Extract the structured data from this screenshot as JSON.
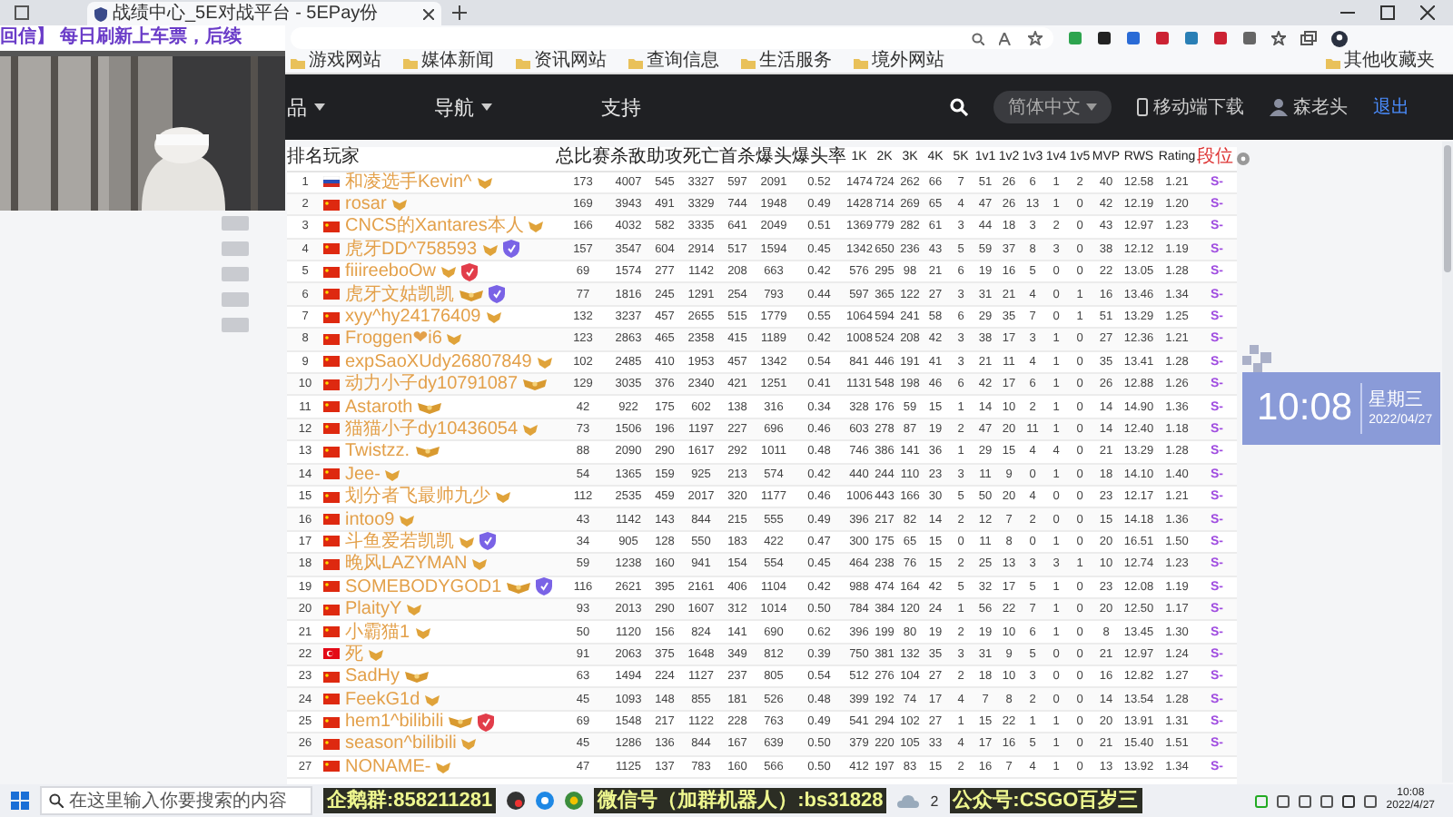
{
  "browser": {
    "tab_title": "战绩中心_5E对战平台 - 5EPay份",
    "bookmarks": [
      "游戏网站",
      "媒体新闻",
      "资讯网站",
      "查询信息",
      "生活服务",
      "境外网站"
    ],
    "other_bookmarks": "其他收藏夹"
  },
  "stream_banner": "回信】 每日刷新上车票，后续",
  "nav": {
    "items": [
      {
        "label": "品",
        "dropdown": true
      },
      {
        "label": "导航",
        "dropdown": true
      },
      {
        "label": "支持",
        "dropdown": false
      }
    ],
    "language": "简体中文",
    "mobile": "移动端下载",
    "user": "森老头",
    "logout": "退出"
  },
  "table": {
    "columns": [
      "排名",
      "玩家",
      "总比赛",
      "杀敌",
      "助攻",
      "死亡",
      "首杀",
      "爆头",
      "爆头率",
      "1K",
      "2K",
      "3K",
      "4K",
      "5K",
      "1v1",
      "1v2",
      "1v3",
      "1v4",
      "1v5",
      "MVP",
      "RWS",
      "Rating",
      "段位"
    ],
    "rows": [
      {
        "rank": "1",
        "flag": {
          "kind": "ru"
        },
        "name": "和凌选手Kevin^",
        "badges": [
          {
            "kind": "gold"
          }
        ],
        "stats": [
          "173",
          "4007",
          "545",
          "3327",
          "597",
          "2091",
          "0.52",
          "1474",
          "724",
          "262",
          "66",
          "7",
          "51",
          "26",
          "6",
          "1",
          "2",
          "40",
          "12.58",
          "1.21"
        ],
        "tier": "S-"
      },
      {
        "rank": "2",
        "flag": {
          "kind": "cn"
        },
        "name": "rosar",
        "badges": [
          {
            "kind": "gold"
          }
        ],
        "stats": [
          "169",
          "3943",
          "491",
          "3329",
          "744",
          "1948",
          "0.49",
          "1428",
          "714",
          "269",
          "65",
          "4",
          "47",
          "26",
          "13",
          "1",
          "0",
          "42",
          "12.19",
          "1.20"
        ],
        "tier": "S-"
      },
      {
        "rank": "3",
        "flag": {
          "kind": "cn"
        },
        "name": "CNCS的Xantares本人",
        "badges": [
          {
            "kind": "gold"
          }
        ],
        "stats": [
          "166",
          "4032",
          "582",
          "3335",
          "641",
          "2049",
          "0.51",
          "1369",
          "779",
          "282",
          "61",
          "3",
          "44",
          "18",
          "3",
          "2",
          "0",
          "43",
          "12.97",
          "1.23"
        ],
        "tier": "S-"
      },
      {
        "rank": "4",
        "flag": {
          "kind": "cn"
        },
        "name": "虎牙DD^758593",
        "badges": [
          {
            "kind": "gold"
          },
          {
            "kind": "purple"
          }
        ],
        "stats": [
          "157",
          "3547",
          "604",
          "2914",
          "517",
          "1594",
          "0.45",
          "1342",
          "650",
          "236",
          "43",
          "5",
          "59",
          "37",
          "8",
          "3",
          "0",
          "38",
          "12.12",
          "1.19"
        ],
        "tier": "S-"
      },
      {
        "rank": "5",
        "flag": {
          "kind": "cn"
        },
        "name": "fiiireeboOw",
        "badges": [
          {
            "kind": "gold"
          },
          {
            "kind": "red"
          }
        ],
        "stats": [
          "69",
          "1574",
          "277",
          "1142",
          "208",
          "663",
          "0.42",
          "576",
          "295",
          "98",
          "21",
          "6",
          "19",
          "16",
          "5",
          "0",
          "0",
          "22",
          "13.05",
          "1.28"
        ],
        "tier": "S-"
      },
      {
        "rank": "6",
        "flag": {
          "kind": "cn"
        },
        "name": "虎牙文姑凯凯",
        "badges": [
          {
            "kind": "gold2"
          },
          {
            "kind": "purple"
          }
        ],
        "stats": [
          "77",
          "1816",
          "245",
          "1291",
          "254",
          "793",
          "0.44",
          "597",
          "365",
          "122",
          "27",
          "3",
          "31",
          "21",
          "4",
          "0",
          "1",
          "16",
          "13.46",
          "1.34"
        ],
        "tier": "S-"
      },
      {
        "rank": "7",
        "flag": {
          "kind": "cn"
        },
        "name": "xyy^hy24176409",
        "badges": [
          {
            "kind": "gold"
          }
        ],
        "stats": [
          "132",
          "3237",
          "457",
          "2655",
          "515",
          "1779",
          "0.55",
          "1064",
          "594",
          "241",
          "58",
          "6",
          "29",
          "35",
          "7",
          "0",
          "1",
          "51",
          "13.29",
          "1.25"
        ],
        "tier": "S-"
      },
      {
        "rank": "8",
        "flag": {
          "kind": "cn"
        },
        "name": "Froggen❤i6",
        "badges": [
          {
            "kind": "gold"
          }
        ],
        "stats": [
          "123",
          "2863",
          "465",
          "2358",
          "415",
          "1189",
          "0.42",
          "1008",
          "524",
          "208",
          "42",
          "3",
          "38",
          "17",
          "3",
          "1",
          "0",
          "27",
          "12.36",
          "1.21"
        ],
        "tier": "S-"
      },
      {
        "rank": "9",
        "flag": {
          "kind": "cn"
        },
        "name": "expSaoXUdy26807849",
        "badges": [
          {
            "kind": "gold"
          }
        ],
        "stats": [
          "102",
          "2485",
          "410",
          "1953",
          "457",
          "1342",
          "0.54",
          "841",
          "446",
          "191",
          "41",
          "3",
          "21",
          "11",
          "4",
          "1",
          "0",
          "35",
          "13.41",
          "1.28"
        ],
        "tier": "S-"
      },
      {
        "rank": "10",
        "flag": {
          "kind": "cn"
        },
        "name": "动力小子dy10791087",
        "badges": [
          {
            "kind": "gold2"
          }
        ],
        "stats": [
          "129",
          "3035",
          "376",
          "2340",
          "421",
          "1251",
          "0.41",
          "1131",
          "548",
          "198",
          "46",
          "6",
          "42",
          "17",
          "6",
          "1",
          "0",
          "26",
          "12.88",
          "1.26"
        ],
        "tier": "S-"
      },
      {
        "rank": "11",
        "flag": {
          "kind": "cn"
        },
        "name": "Astaroth",
        "badges": [
          {
            "kind": "gold2"
          }
        ],
        "stats": [
          "42",
          "922",
          "175",
          "602",
          "138",
          "316",
          "0.34",
          "328",
          "176",
          "59",
          "15",
          "1",
          "14",
          "10",
          "2",
          "1",
          "0",
          "14",
          "14.90",
          "1.36"
        ],
        "tier": "S-"
      },
      {
        "rank": "12",
        "flag": {
          "kind": "cn"
        },
        "name": "猫猫小子dy10436054",
        "badges": [
          {
            "kind": "gold"
          }
        ],
        "stats": [
          "73",
          "1506",
          "196",
          "1197",
          "227",
          "696",
          "0.46",
          "603",
          "278",
          "87",
          "19",
          "2",
          "47",
          "20",
          "11",
          "1",
          "0",
          "14",
          "12.40",
          "1.18"
        ],
        "tier": "S-"
      },
      {
        "rank": "13",
        "flag": {
          "kind": "cn"
        },
        "name": "Twistzz.",
        "badges": [
          {
            "kind": "gold2"
          }
        ],
        "stats": [
          "88",
          "2090",
          "290",
          "1617",
          "292",
          "1011",
          "0.48",
          "746",
          "386",
          "141",
          "36",
          "1",
          "29",
          "15",
          "4",
          "4",
          "0",
          "21",
          "13.29",
          "1.28"
        ],
        "tier": "S-"
      },
      {
        "rank": "14",
        "flag": {
          "kind": "cn"
        },
        "name": "Jee-",
        "badges": [
          {
            "kind": "gold"
          }
        ],
        "stats": [
          "54",
          "1365",
          "159",
          "925",
          "213",
          "574",
          "0.42",
          "440",
          "244",
          "110",
          "23",
          "3",
          "11",
          "9",
          "0",
          "1",
          "0",
          "18",
          "14.10",
          "1.40"
        ],
        "tier": "S-"
      },
      {
        "rank": "15",
        "flag": {
          "kind": "cn"
        },
        "name": "划分者飞最帅九少",
        "badges": [
          {
            "kind": "gold"
          }
        ],
        "stats": [
          "112",
          "2535",
          "459",
          "2017",
          "320",
          "1177",
          "0.46",
          "1006",
          "443",
          "166",
          "30",
          "5",
          "50",
          "20",
          "4",
          "0",
          "0",
          "23",
          "12.17",
          "1.21"
        ],
        "tier": "S-"
      },
      {
        "rank": "16",
        "flag": {
          "kind": "cn"
        },
        "name": "intoo9",
        "badges": [
          {
            "kind": "gold"
          }
        ],
        "stats": [
          "43",
          "1142",
          "143",
          "844",
          "215",
          "555",
          "0.49",
          "396",
          "217",
          "82",
          "14",
          "2",
          "12",
          "7",
          "2",
          "0",
          "0",
          "15",
          "14.18",
          "1.36"
        ],
        "tier": "S-"
      },
      {
        "rank": "17",
        "flag": {
          "kind": "cn"
        },
        "name": "斗鱼爱若凯凯",
        "badges": [
          {
            "kind": "gold"
          },
          {
            "kind": "purple"
          }
        ],
        "stats": [
          "34",
          "905",
          "128",
          "550",
          "183",
          "422",
          "0.47",
          "300",
          "175",
          "65",
          "15",
          "0",
          "11",
          "8",
          "0",
          "1",
          "0",
          "20",
          "16.51",
          "1.50"
        ],
        "tier": "S-"
      },
      {
        "rank": "18",
        "flag": {
          "kind": "cn"
        },
        "name": "晚风LAZYMAN",
        "badges": [
          {
            "kind": "gold"
          }
        ],
        "stats": [
          "59",
          "1238",
          "160",
          "941",
          "154",
          "554",
          "0.45",
          "464",
          "238",
          "76",
          "15",
          "2",
          "25",
          "13",
          "3",
          "3",
          "1",
          "10",
          "12.74",
          "1.23"
        ],
        "tier": "S-"
      },
      {
        "rank": "19",
        "flag": {
          "kind": "cn"
        },
        "name": "SOMEBODYGOD1",
        "badges": [
          {
            "kind": "gold2"
          },
          {
            "kind": "purple"
          }
        ],
        "stats": [
          "116",
          "2621",
          "395",
          "2161",
          "406",
          "1104",
          "0.42",
          "988",
          "474",
          "164",
          "42",
          "5",
          "32",
          "17",
          "5",
          "1",
          "0",
          "23",
          "12.08",
          "1.19"
        ],
        "tier": "S-"
      },
      {
        "rank": "20",
        "flag": {
          "kind": "cn"
        },
        "name": "PlaityY",
        "badges": [
          {
            "kind": "gold"
          }
        ],
        "stats": [
          "93",
          "2013",
          "290",
          "1607",
          "312",
          "1014",
          "0.50",
          "784",
          "384",
          "120",
          "24",
          "1",
          "56",
          "22",
          "7",
          "1",
          "0",
          "20",
          "12.50",
          "1.17"
        ],
        "tier": "S-"
      },
      {
        "rank": "21",
        "flag": {
          "kind": "cn"
        },
        "name": "小霸猫1",
        "badges": [
          {
            "kind": "gold"
          }
        ],
        "stats": [
          "50",
          "1120",
          "156",
          "824",
          "141",
          "690",
          "0.62",
          "396",
          "199",
          "80",
          "19",
          "2",
          "19",
          "10",
          "6",
          "1",
          "0",
          "8",
          "13.45",
          "1.30"
        ],
        "tier": "S-"
      },
      {
        "rank": "22",
        "flag": {
          "kind": "tr"
        },
        "name": "死",
        "badges": [
          {
            "kind": "gold"
          }
        ],
        "stats": [
          "91",
          "2063",
          "375",
          "1648",
          "349",
          "812",
          "0.39",
          "750",
          "381",
          "132",
          "35",
          "3",
          "31",
          "9",
          "5",
          "0",
          "0",
          "21",
          "12.97",
          "1.24"
        ],
        "tier": "S-"
      },
      {
        "rank": "23",
        "flag": {
          "kind": "cn"
        },
        "name": "SadHy",
        "badges": [
          {
            "kind": "gold2"
          }
        ],
        "stats": [
          "63",
          "1494",
          "224",
          "1127",
          "237",
          "805",
          "0.54",
          "512",
          "276",
          "104",
          "27",
          "2",
          "18",
          "10",
          "3",
          "0",
          "0",
          "16",
          "12.82",
          "1.27"
        ],
        "tier": "S-"
      },
      {
        "rank": "24",
        "flag": {
          "kind": "cn"
        },
        "name": "FeekG1d",
        "badges": [
          {
            "kind": "gold"
          }
        ],
        "stats": [
          "45",
          "1093",
          "148",
          "855",
          "181",
          "526",
          "0.48",
          "399",
          "192",
          "74",
          "17",
          "4",
          "7",
          "8",
          "2",
          "0",
          "0",
          "14",
          "13.54",
          "1.28"
        ],
        "tier": "S-"
      },
      {
        "rank": "25",
        "flag": {
          "kind": "cn"
        },
        "name": "hem1^bilibili",
        "badges": [
          {
            "kind": "gold2"
          },
          {
            "kind": "red"
          }
        ],
        "stats": [
          "69",
          "1548",
          "217",
          "1122",
          "228",
          "763",
          "0.49",
          "541",
          "294",
          "102",
          "27",
          "1",
          "15",
          "22",
          "1",
          "1",
          "0",
          "20",
          "13.91",
          "1.31"
        ],
        "tier": "S-"
      },
      {
        "rank": "26",
        "flag": {
          "kind": "cn"
        },
        "name": "season^bilibili",
        "badges": [
          {
            "kind": "gold"
          }
        ],
        "stats": [
          "45",
          "1286",
          "136",
          "844",
          "167",
          "639",
          "0.50",
          "379",
          "220",
          "105",
          "33",
          "4",
          "17",
          "16",
          "5",
          "1",
          "0",
          "21",
          "15.40",
          "1.51"
        ],
        "tier": "S-"
      },
      {
        "rank": "27",
        "flag": {
          "kind": "cn"
        },
        "name": "NONAME-",
        "badges": [
          {
            "kind": "gold"
          }
        ],
        "stats": [
          "47",
          "1125",
          "137",
          "783",
          "160",
          "566",
          "0.50",
          "412",
          "197",
          "83",
          "15",
          "2",
          "16",
          "7",
          "4",
          "1",
          "0",
          "13",
          "13.92",
          "1.34"
        ],
        "tier": "S-"
      }
    ]
  },
  "clock_widget": {
    "time": "10:08",
    "weekday": "星期三",
    "date": "2022/04/27"
  },
  "taskbar": {
    "search_placeholder": "在这里输入你要搜索的内容",
    "overlays": [
      "企鹅群:858211281",
      "微信号（加群机器人）:bs31828",
      "公众号:CSGO百岁三"
    ],
    "tray_count": "2",
    "time": "10:08",
    "date": "2022/4/27"
  }
}
